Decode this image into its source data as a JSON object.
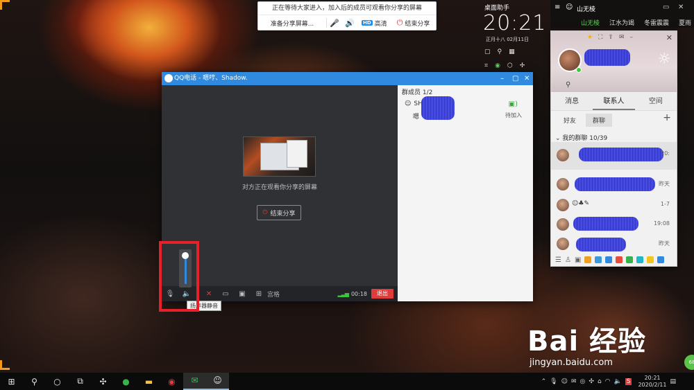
{
  "share_bar": {
    "message": "正在等待大家进入，加入后的成员可观看你分享的屏幕",
    "prepare_label": "准备分享屏幕...",
    "mic_icon": "microphone-icon",
    "speaker_icon": "speaker-icon",
    "hd_badge": "HD",
    "hd_label": "高清",
    "end_label": "结束分享"
  },
  "desk_assistant": {
    "title": "桌面助手",
    "time": "20:21",
    "date_line": "正月十八          02月11日"
  },
  "qq_strip": {
    "name": "山无棱",
    "tabs": [
      "山无棱",
      "江水为竭",
      "冬雷震震",
      "夏雨"
    ]
  },
  "qq_panel": {
    "tabs": [
      "消息",
      "联系人",
      "空间"
    ],
    "sub_tabs": [
      "好友",
      "群聊"
    ],
    "group_header": "我的群聊 10/39",
    "items": [
      {
        "time": "20:"
      },
      {
        "time": "昨天"
      },
      {
        "time": "1-7"
      },
      {
        "time": "19:08"
      },
      {
        "time": "昨天"
      }
    ]
  },
  "call_window": {
    "title": "QQ电话 - 嗯哼、Shadow.",
    "share_status": "对方正在观看你分享的屏幕",
    "end_share_label": "结束分享",
    "toolbar_label": "宫格",
    "duration": "00:18",
    "exit_label": "退出",
    "tooltip": "扬声器静音"
  },
  "members": {
    "header": "群成员 1/2",
    "row1_prefix": "SH",
    "row2_prefix": "嗯",
    "invite": "待加入"
  },
  "watermark": {
    "brand": "Bai 经验",
    "url": "jingyan.baidu.com"
  },
  "taskbar": {
    "time": "20:21",
    "date": "2020/2/11",
    "badge": "68"
  },
  "colors": {
    "accent": "#2f8ae0",
    "exit_red": "#e03c3c",
    "annotation_red": "#e8202a",
    "scribble_blue": "#3a3fe0"
  }
}
